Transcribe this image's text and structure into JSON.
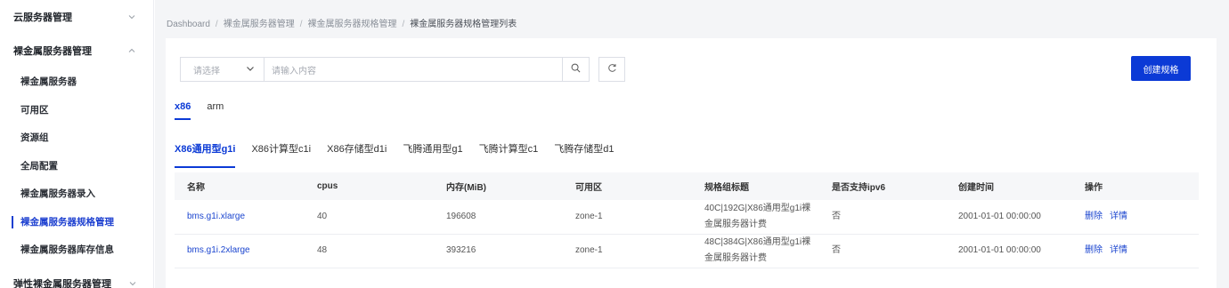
{
  "sidebar": {
    "group1": {
      "label": "云服务器管理"
    },
    "group2": {
      "label": "裸金属服务器管理"
    },
    "items": [
      {
        "label": "裸金属服务器"
      },
      {
        "label": "可用区"
      },
      {
        "label": "资源组"
      },
      {
        "label": "全局配置"
      },
      {
        "label": "裸金属服务器录入"
      },
      {
        "label": "裸金属服务器规格管理"
      },
      {
        "label": "裸金属服务器库存信息"
      }
    ],
    "group3": {
      "label": "弹性裸金属服务器管理"
    }
  },
  "breadcrumb": [
    "Dashboard",
    "裸金属服务器管理",
    "裸金属服务器规格管理",
    "裸金属服务器规格管理列表"
  ],
  "breadcrumb_sep": "/",
  "search": {
    "select_placeholder": "请选择",
    "input_placeholder": "请输入内容"
  },
  "create_button": "创建规格",
  "arch_tabs": [
    "x86",
    "arm"
  ],
  "type_tabs": [
    "X86通用型g1i",
    "X86计算型c1i",
    "X86存储型d1i",
    "飞腾通用型g1",
    "飞腾计算型c1",
    "飞腾存储型d1"
  ],
  "table": {
    "headers": [
      "名称",
      "cpus",
      "内存(MiB)",
      "可用区",
      "规格组标题",
      "是否支持ipv6",
      "创建时间",
      "操作"
    ],
    "rows": [
      {
        "name": "bms.g1i.xlarge",
        "cpus": "40",
        "memory": "196608",
        "zone": "zone-1",
        "group_title_1": "40C|192G|X86通用型g1i裸",
        "group_title_2": "金属服务器计费",
        "ipv6": "否",
        "created": "2001-01-01 00:00:00",
        "action_delete": "删除",
        "action_detail": "详情"
      },
      {
        "name": "bms.g1i.2xlarge",
        "cpus": "48",
        "memory": "393216",
        "zone": "zone-1",
        "group_title_1": "48C|384G|X86通用型g1i裸",
        "group_title_2": "金属服务器计费",
        "ipv6": "否",
        "created": "2001-01-01 00:00:00",
        "action_delete": "删除",
        "action_detail": "详情"
      }
    ]
  },
  "icons": {
    "search": "search-icon",
    "refresh": "refresh-icon",
    "chevron": "chevron-icon"
  },
  "colors": {
    "accent": "#0b3ad6",
    "link": "#1b45cf"
  }
}
